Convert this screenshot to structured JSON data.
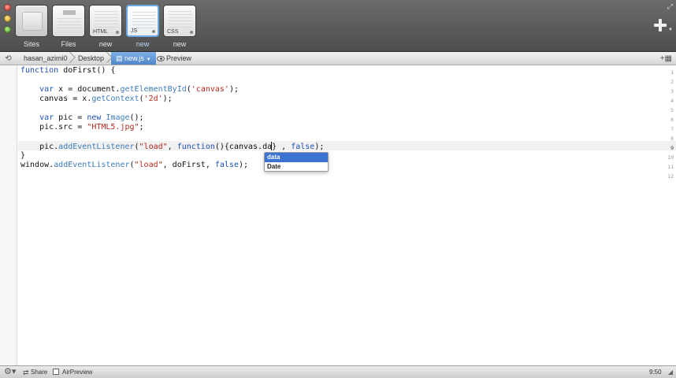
{
  "tabs": [
    {
      "label": "Sites",
      "thumb_name": ""
    },
    {
      "label": "Files",
      "thumb_name": ""
    },
    {
      "label": "new",
      "thumb_name": "HTML"
    },
    {
      "label": "new",
      "thumb_name": "JS"
    },
    {
      "label": "new",
      "thumb_name": "CSS"
    }
  ],
  "pathbar": {
    "crumbs": [
      "hasan_azimi0",
      "Desktop",
      "new.js"
    ],
    "preview_label": "Preview"
  },
  "editor": {
    "line_numbers": [
      "1",
      "2",
      "3",
      "4",
      "5",
      "6",
      "7",
      "8",
      "9",
      "10",
      "11",
      "12"
    ],
    "current_line": 9
  },
  "autocomplete": {
    "items": [
      "data",
      "Date"
    ],
    "selected": 0
  },
  "statusbar": {
    "share_label": "Share",
    "airpreview_label": "AirPreview",
    "cursor_position": "9:50"
  },
  "colors": {
    "keyword": "#1f4fb3",
    "method": "#3e7bb8",
    "string": "#b12a1e",
    "selection": "#3b74d0"
  }
}
